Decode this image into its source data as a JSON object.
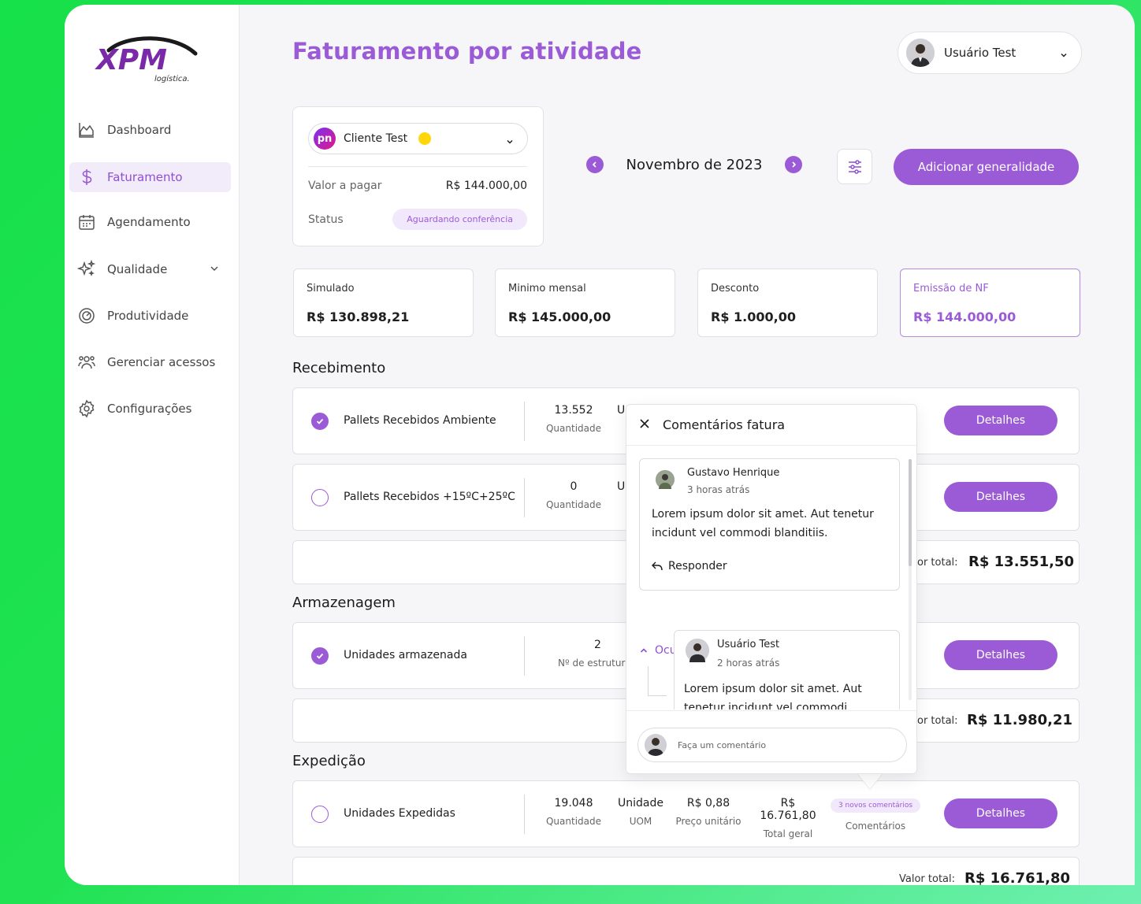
{
  "brand": {
    "logo_main": "XPM",
    "logo_sub": "logística."
  },
  "sidebar": {
    "items": [
      {
        "label": "Dashboard",
        "icon": "chart-area-icon"
      },
      {
        "label": "Faturamento",
        "icon": "dollar-icon"
      },
      {
        "label": "Agendamento",
        "icon": "calendar-icon"
      },
      {
        "label": "Qualidade",
        "icon": "sparkles-icon"
      },
      {
        "label": "Produtividade",
        "icon": "gauge-icon"
      },
      {
        "label": "Gerenciar acessos",
        "icon": "users-icon"
      },
      {
        "label": "Configurações",
        "icon": "gear-icon"
      }
    ]
  },
  "header": {
    "title": "Faturamento por atividade",
    "user_name": "Usuário Test"
  },
  "client": {
    "name": "Cliente Test",
    "logo_text": "pn",
    "amount_label": "Valor a pagar",
    "amount_value": "R$ 144.000,00",
    "status_label": "Status",
    "status_value": "Aguardando conferência"
  },
  "period": {
    "label": "Novembro de 2023"
  },
  "actions": {
    "add_label": "Adicionar generalidade"
  },
  "stats": [
    {
      "label": "Simulado",
      "value": "R$ 130.898,21"
    },
    {
      "label": "Minimo mensal",
      "value": "R$ 145.000,00"
    },
    {
      "label": "Desconto",
      "value": "R$ 1.000,00"
    },
    {
      "label": "Emissão de NF",
      "value": "R$ 144.000,00"
    }
  ],
  "sections": {
    "recebimento": {
      "title": "Recebimento",
      "rows": [
        {
          "name": "Pallets Recebidos Ambiente",
          "qty": "13.552",
          "qty_label": "Quantidade",
          "uom_partial": "Ur",
          "details": "Detalhes"
        },
        {
          "name": "Pallets Recebidos +15ºC+25ºC",
          "qty": "0",
          "qty_label": "Quantidade",
          "uom_partial": "Ur",
          "details": "Detalhes"
        }
      ],
      "total_label": "or total:",
      "total_value": "R$ 13.551,50"
    },
    "armazenagem": {
      "title": "Armazenagem",
      "rows": [
        {
          "name": "Unidades armazenada",
          "qty": "2",
          "qty_label": "Nº de estrutur",
          "details": "Detalhes"
        }
      ],
      "total_label": "or total:",
      "total_value": "R$ 11.980,21"
    },
    "expedicao": {
      "title": "Expedição",
      "row": {
        "name": "Unidades Expedidas",
        "qty": "19.048",
        "qty_label": "Quantidade",
        "uom": "Unidade",
        "uom_label": "UOM",
        "price": "R$ 0,88",
        "price_label": "Preço unitário",
        "total": "R$ 16.761,80",
        "total_label": "Total geral",
        "comments_chip": "3 novos comentários",
        "comments_label": "Comentários",
        "details": "Detalhes"
      },
      "total_label": "Valor total:",
      "total_value": "R$ 16.761,80"
    }
  },
  "comments_popover": {
    "title": "Comentários fatura",
    "comments": [
      {
        "author": "Gustavo Henrique",
        "time": "3 horas atrás",
        "text": "Lorem ipsum dolor sit amet. Aut tenetur incidunt vel commodi blanditiis.",
        "reply_label": "Responder"
      }
    ],
    "hide_replies_label": "Ocultar respostas",
    "replies": [
      {
        "author": "Usuário Test",
        "time": "2 horas atrás",
        "text": "Lorem ipsum dolor sit amet. Aut tenetur incidunt vel commodi"
      }
    ],
    "input_placeholder": "Faça um comentário"
  },
  "colors": {
    "accent": "#9b5bd6",
    "chip_bg": "#f1e8fb",
    "status_yellow": "#ffd60a"
  }
}
